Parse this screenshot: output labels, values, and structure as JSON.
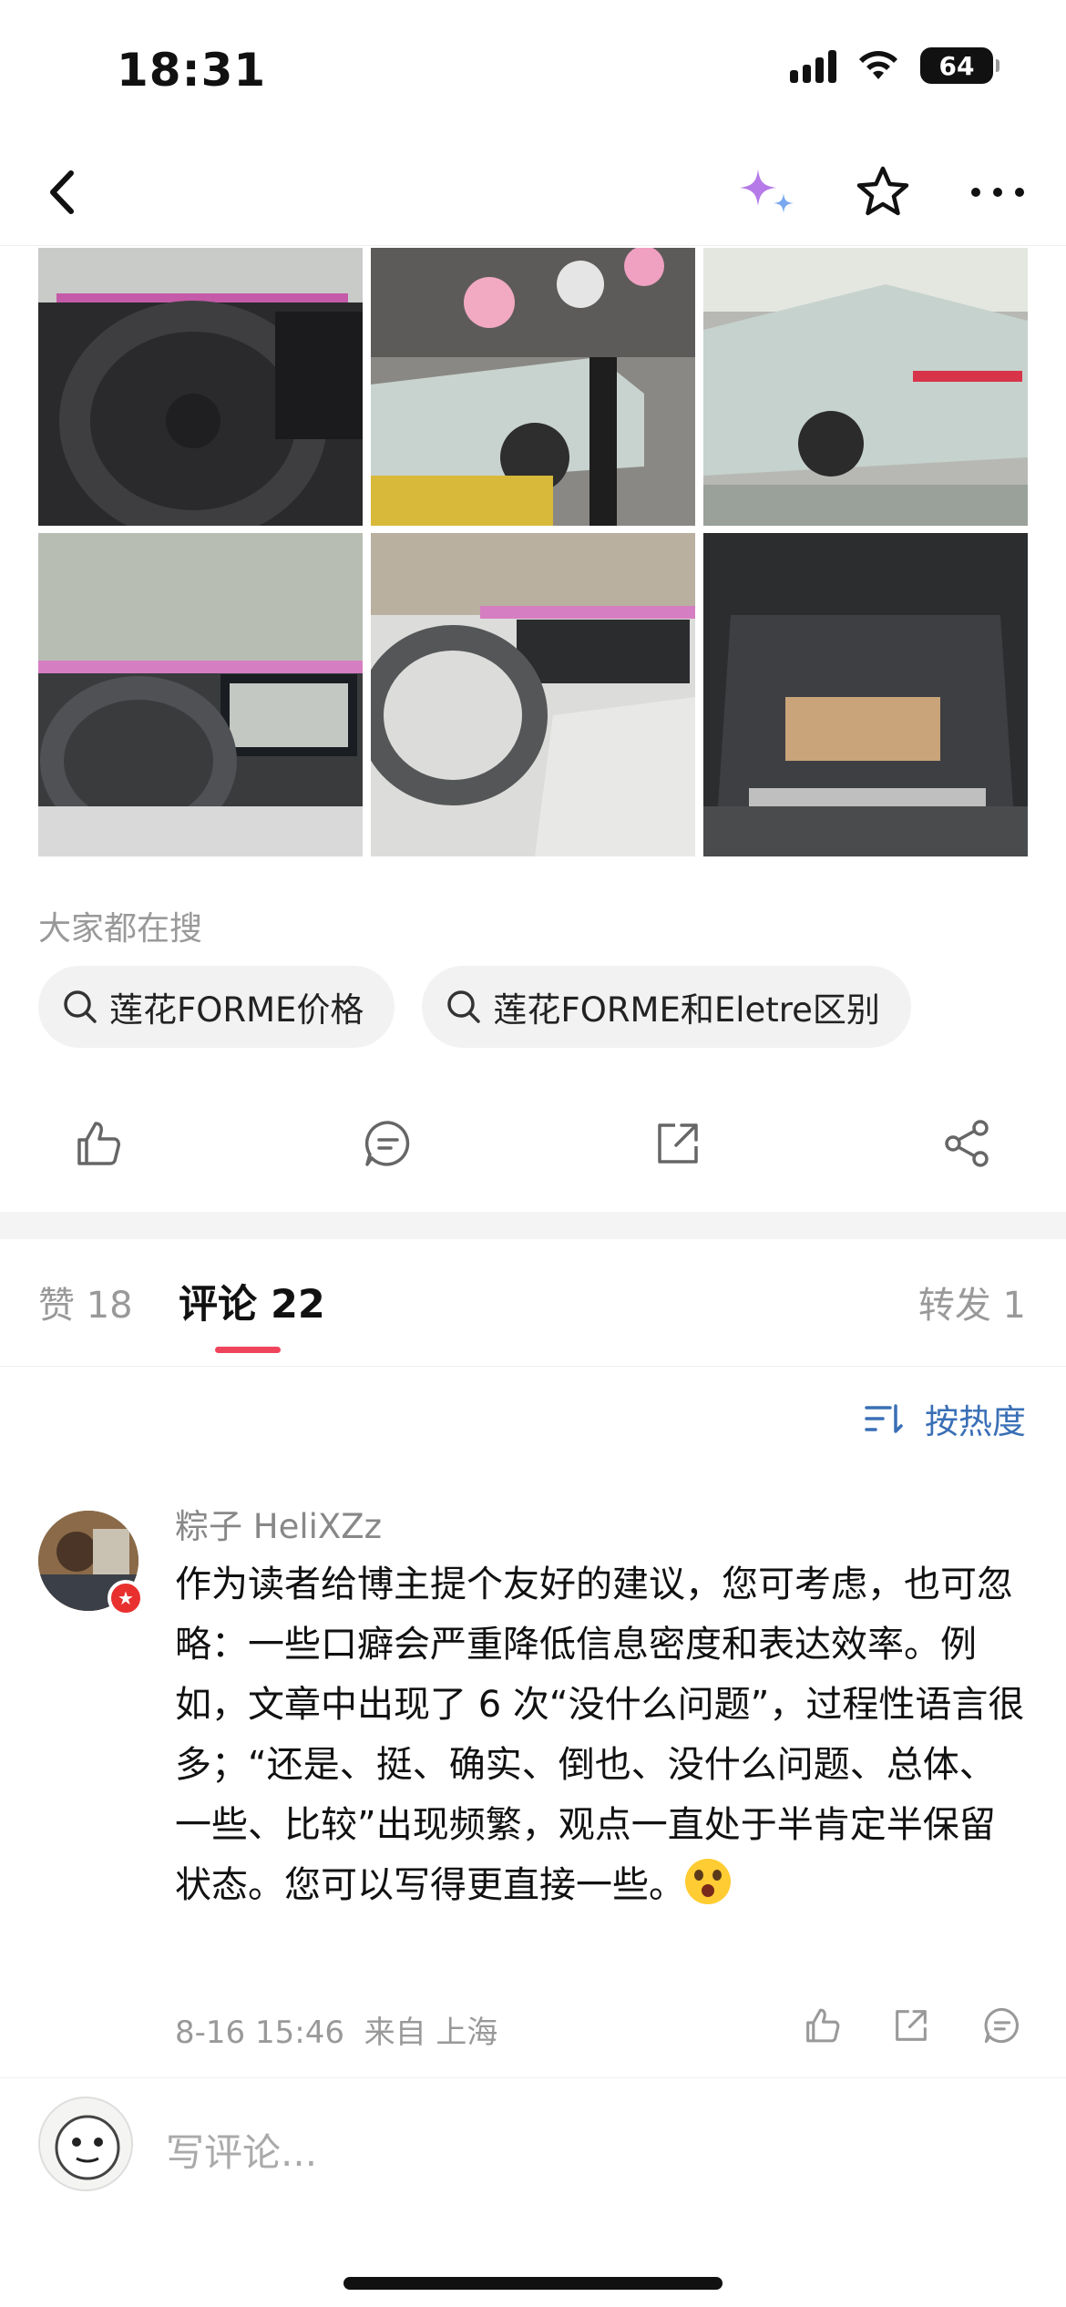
{
  "status": {
    "time": "18:31",
    "battery": "64"
  },
  "nav": {
    "back": "back",
    "ai": "sparkle",
    "favorite": "star",
    "more": "more"
  },
  "search": {
    "heading": "大家都在搜",
    "chips": [
      "莲花FORME价格",
      "莲花FORME和Eletre区别"
    ]
  },
  "tabs": {
    "likes": "赞 18",
    "comments": "评论 22",
    "reposts": "转发 1"
  },
  "sort_label": "按热度",
  "comment": {
    "author": "粽子 HeliXZz",
    "text": "作为读者给博主提个友好的建议，您可考虑，也可忽略：一些口癖会严重降低信息密度和表达效率。例如，文章中出现了 6 次“没什么问题”，过程性语言很多；“还是、挺、确实、倒也、没什么问题、总体、一些、比较”出现频繁，观点一直处于半肯定半保留状态。您可以写得更直接一些。",
    "time": "8-16 15:46",
    "location": "来自 上海"
  },
  "input_placeholder": "写评论...",
  "colors": {
    "accent_red": "#f0445c",
    "link_blue": "#3a6fb6",
    "muted": "#999999"
  }
}
